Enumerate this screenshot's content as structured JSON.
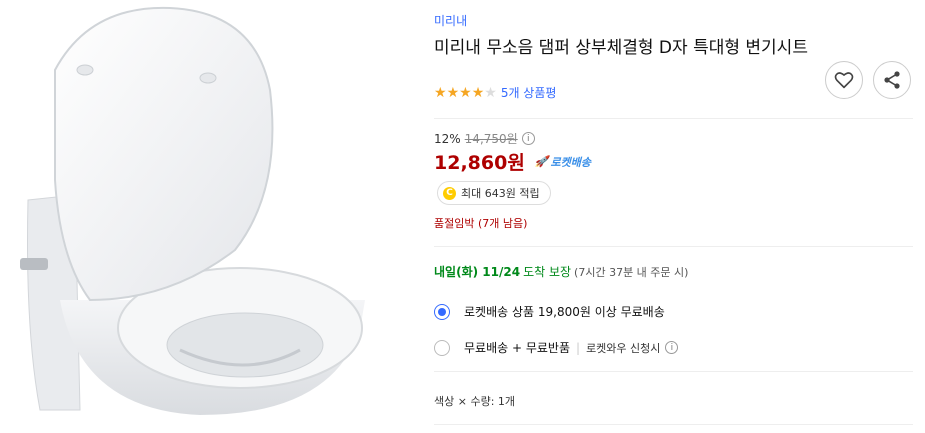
{
  "brand": "미리내",
  "title": "미리내 무소음 댐퍼 상부체결형 D자 특대형 변기시트",
  "rating": {
    "value": 4,
    "max": 5,
    "review_text": "5개 상품평"
  },
  "price": {
    "discount": "12%",
    "original": "14,750원",
    "sale": "12,860원",
    "badge": "로켓배송"
  },
  "points": {
    "coin_label": "C",
    "text": "최대 643원 적립"
  },
  "stock": "품절임박 (7개 남음)",
  "delivery": {
    "date": "내일(화) 11/24",
    "guarantee": "도착 보장",
    "note": "(7시간 37분 내 주문 시)"
  },
  "shipping_options": [
    {
      "label": "로켓배송 상품 19,800원 이상 무료배송",
      "selected": true
    },
    {
      "label": "무료배송 + 무료반품",
      "sub": "로켓와우 신청시",
      "selected": false
    }
  ],
  "option_line": "색상 × 수량: 1개",
  "icons": {
    "heart": "heart-icon",
    "share": "share-icon",
    "info": "info-icon",
    "rocket": "rocket-icon"
  },
  "colors": {
    "brand_blue": "#346aff",
    "price_red": "#ae0000",
    "delivery_green": "#00891a",
    "star": "#f5a623"
  }
}
